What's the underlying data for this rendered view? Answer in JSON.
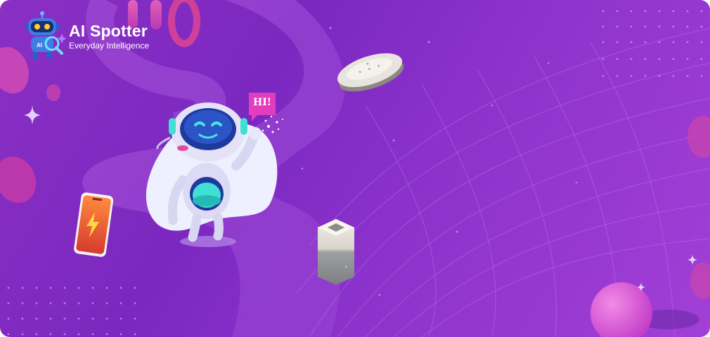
{
  "brand": {
    "name": "AI Spotter",
    "tagline": "Everyday Intelligence"
  },
  "speech_bubble": {
    "text": "HI!"
  },
  "icons": {
    "logo": "robot-magnifier-icon",
    "sparkle": "sparkle-icon",
    "lightning": "lightning-icon"
  },
  "colors": {
    "background_start": "#8a2fc4",
    "background_end": "#a23fd6",
    "accent_pink": "#e23cbf",
    "robot_teal": "#34e4d8"
  }
}
